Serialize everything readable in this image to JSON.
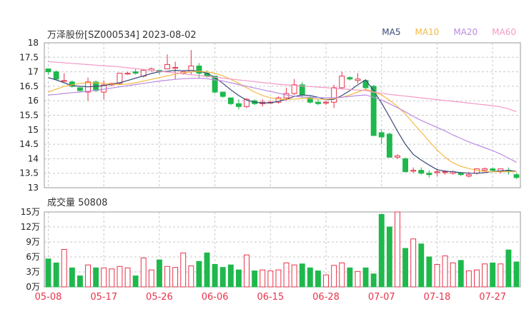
{
  "header": {
    "title": "万泽股份[SZ000534] 2023-08-02",
    "legend": [
      {
        "label": "MA5",
        "color": "#3a4a7a"
      },
      {
        "label": "MA10",
        "color": "#f5b942"
      },
      {
        "label": "MA20",
        "color": "#b98ae0"
      },
      {
        "label": "MA60",
        "color": "#f29ac6"
      }
    ]
  },
  "volume_label": "成交量 50808",
  "colors": {
    "up": "#e8334a",
    "down": "#1fb84c",
    "grid": "#c8c8c8",
    "axis": "#222222",
    "date": "#e8334a"
  },
  "chart_data": [
    {
      "type": "candlestick",
      "title": "万泽股份[SZ000534] 2023-08-02",
      "ylim": [
        13,
        18
      ],
      "y_ticks": [
        13,
        13.5,
        14,
        14.5,
        15,
        15.5,
        16,
        16.5,
        17,
        17.5,
        18
      ],
      "x_tick_labels": [
        {
          "label": "05-08",
          "index": 0
        },
        {
          "label": "05-17",
          "index": 7
        },
        {
          "label": "05-26",
          "index": 14
        },
        {
          "label": "06-06",
          "index": 21
        },
        {
          "label": "06-15",
          "index": 28
        },
        {
          "label": "06-28",
          "index": 35
        },
        {
          "label": "07-07",
          "index": 42
        },
        {
          "label": "07-18",
          "index": 49
        },
        {
          "label": "07-27",
          "index": 56
        }
      ],
      "ohlc": [
        [
          17.1,
          17.1,
          16.9,
          17.0
        ],
        [
          17.0,
          17.05,
          16.7,
          16.75
        ],
        [
          16.7,
          16.95,
          16.65,
          16.7
        ],
        [
          16.65,
          16.7,
          16.45,
          16.5
        ],
        [
          16.45,
          16.45,
          16.3,
          16.35
        ],
        [
          16.3,
          16.8,
          16.0,
          16.65
        ],
        [
          16.65,
          16.7,
          16.3,
          16.35
        ],
        [
          16.3,
          16.7,
          16.05,
          16.55
        ],
        [
          16.55,
          16.6,
          16.5,
          16.6
        ],
        [
          16.6,
          16.95,
          16.55,
          16.95
        ],
        [
          16.95,
          17.0,
          16.9,
          16.95
        ],
        [
          17.0,
          17.1,
          16.9,
          16.95
        ],
        [
          16.85,
          17.1,
          16.8,
          17.05
        ],
        [
          17.05,
          17.15,
          17.0,
          17.1
        ],
        [
          17.05,
          17.05,
          16.9,
          17.0
        ],
        [
          17.1,
          17.6,
          17.1,
          17.25
        ],
        [
          17.15,
          17.35,
          16.75,
          17.15
        ],
        [
          16.95,
          17.0,
          16.9,
          17.0
        ],
        [
          17.0,
          17.75,
          16.9,
          17.2
        ],
        [
          17.2,
          17.3,
          16.8,
          16.95
        ],
        [
          16.95,
          17.05,
          16.8,
          16.85
        ],
        [
          16.85,
          16.85,
          16.25,
          16.3
        ],
        [
          16.3,
          16.3,
          16.1,
          16.15
        ],
        [
          16.1,
          16.1,
          15.85,
          15.9
        ],
        [
          15.9,
          16.05,
          15.7,
          15.8
        ],
        [
          15.8,
          16.1,
          15.75,
          16.05
        ],
        [
          16.0,
          16.05,
          15.85,
          15.9
        ],
        [
          15.9,
          16.05,
          15.8,
          15.95
        ],
        [
          15.95,
          16.0,
          15.9,
          15.95
        ],
        [
          15.95,
          16.15,
          15.9,
          16.1
        ],
        [
          16.1,
          16.45,
          16.0,
          16.25
        ],
        [
          16.25,
          16.75,
          16.2,
          16.55
        ],
        [
          16.55,
          16.65,
          16.1,
          16.2
        ],
        [
          16.1,
          16.15,
          15.9,
          15.95
        ],
        [
          15.95,
          16.05,
          15.85,
          15.9
        ],
        [
          15.95,
          16.0,
          15.85,
          15.95
        ],
        [
          15.95,
          16.55,
          15.75,
          16.45
        ],
        [
          16.45,
          17.0,
          16.4,
          16.85
        ],
        [
          16.8,
          16.85,
          16.7,
          16.75
        ],
        [
          16.7,
          16.95,
          16.6,
          16.75
        ],
        [
          16.7,
          16.75,
          16.35,
          16.45
        ],
        [
          16.5,
          16.55,
          14.8,
          14.8
        ],
        [
          14.9,
          15.0,
          14.5,
          14.75
        ],
        [
          14.85,
          14.9,
          14.05,
          14.05
        ],
        [
          14.05,
          14.15,
          14.0,
          14.1
        ],
        [
          14.0,
          14.05,
          13.55,
          13.55
        ],
        [
          13.6,
          13.7,
          13.5,
          13.6
        ],
        [
          13.6,
          13.7,
          13.45,
          13.5
        ],
        [
          13.5,
          13.6,
          13.35,
          13.45
        ],
        [
          13.55,
          13.65,
          13.4,
          13.55
        ],
        [
          13.55,
          13.6,
          13.45,
          13.55
        ],
        [
          13.5,
          13.6,
          13.45,
          13.55
        ],
        [
          13.5,
          13.5,
          13.4,
          13.45
        ],
        [
          13.4,
          13.55,
          13.35,
          13.45
        ],
        [
          13.5,
          13.65,
          13.45,
          13.65
        ],
        [
          13.6,
          13.7,
          13.55,
          13.65
        ],
        [
          13.65,
          13.7,
          13.55,
          13.6
        ],
        [
          13.55,
          13.65,
          13.5,
          13.65
        ],
        [
          13.6,
          13.7,
          13.45,
          13.55
        ],
        [
          13.45,
          13.5,
          13.3,
          13.35
        ]
      ],
      "ma": {
        "MA5": [
          16.8,
          16.72,
          16.62,
          16.52,
          16.5,
          16.48,
          16.5,
          16.52,
          16.58,
          16.62,
          16.7,
          16.78,
          16.86,
          16.94,
          17.0,
          17.02,
          17.05,
          17.04,
          17.05,
          17.02,
          16.95,
          16.8,
          16.6,
          16.38,
          16.18,
          16.02,
          15.95,
          15.92,
          15.93,
          15.98,
          16.05,
          16.15,
          16.2,
          16.18,
          16.12,
          16.04,
          16.05,
          16.18,
          16.35,
          16.55,
          16.72,
          16.35,
          15.92,
          15.45,
          14.95,
          14.5,
          14.15,
          13.95,
          13.78,
          13.62,
          13.57,
          13.55,
          13.52,
          13.5,
          13.5,
          13.52,
          13.56,
          13.58,
          13.6,
          13.56
        ],
        "MA10": [
          16.3,
          16.4,
          16.5,
          16.55,
          16.6,
          16.62,
          16.62,
          16.6,
          16.58,
          16.56,
          16.58,
          16.62,
          16.68,
          16.74,
          16.8,
          16.86,
          16.92,
          16.96,
          17.0,
          17.02,
          17.0,
          16.95,
          16.86,
          16.74,
          16.6,
          16.45,
          16.3,
          16.18,
          16.1,
          16.06,
          16.05,
          16.06,
          16.08,
          16.08,
          16.06,
          16.05,
          16.08,
          16.12,
          16.2,
          16.3,
          16.4,
          16.3,
          16.2,
          16.02,
          15.8,
          15.55,
          15.22,
          14.92,
          14.6,
          14.3,
          14.05,
          13.86,
          13.74,
          13.66,
          13.6,
          13.56,
          13.55,
          13.55,
          13.56,
          13.55
        ],
        "MA20": [
          16.2,
          16.22,
          16.25,
          16.28,
          16.3,
          16.33,
          16.36,
          16.4,
          16.44,
          16.48,
          16.52,
          16.56,
          16.6,
          16.64,
          16.68,
          16.71,
          16.74,
          16.76,
          16.77,
          16.78,
          16.76,
          16.72,
          16.68,
          16.62,
          16.56,
          16.5,
          16.44,
          16.38,
          16.32,
          16.26,
          16.2,
          16.16,
          16.13,
          16.12,
          16.11,
          16.1,
          16.1,
          16.12,
          16.15,
          16.18,
          16.2,
          16.12,
          16.02,
          15.9,
          15.76,
          15.62,
          15.46,
          15.32,
          15.2,
          15.08,
          14.96,
          14.82,
          14.7,
          14.58,
          14.48,
          14.38,
          14.28,
          14.16,
          14.02,
          13.88
        ],
        "MA60": [
          17.35,
          17.33,
          17.31,
          17.29,
          17.27,
          17.25,
          17.23,
          17.21,
          17.19,
          17.17,
          17.14,
          17.11,
          17.08,
          17.05,
          17.02,
          16.99,
          16.96,
          16.93,
          16.9,
          16.87,
          16.84,
          16.81,
          16.78,
          16.75,
          16.72,
          16.69,
          16.66,
          16.63,
          16.6,
          16.57,
          16.55,
          16.53,
          16.51,
          16.49,
          16.47,
          16.45,
          16.43,
          16.41,
          16.39,
          16.37,
          16.35,
          16.3,
          16.26,
          16.22,
          16.19,
          16.16,
          16.13,
          16.1,
          16.07,
          16.04,
          16.01,
          15.98,
          15.95,
          15.92,
          15.89,
          15.86,
          15.83,
          15.79,
          15.72,
          15.62
        ]
      }
    },
    {
      "type": "bar",
      "title": "成交量 50808",
      "ylim": [
        0,
        150000
      ],
      "y_ticks": [
        {
          "value": 0,
          "label": "0万"
        },
        {
          "value": 30000,
          "label": "3万"
        },
        {
          "value": 60000,
          "label": "6万"
        },
        {
          "value": 90000,
          "label": "9万"
        },
        {
          "value": 120000,
          "label": "12万"
        },
        {
          "value": 150000,
          "label": "15万"
        }
      ],
      "values": [
        56000,
        48000,
        75000,
        38000,
        22000,
        44000,
        38000,
        38000,
        36000,
        41000,
        38000,
        22000,
        58000,
        34000,
        54000,
        41000,
        39000,
        68000,
        42000,
        51000,
        68000,
        45000,
        39000,
        44000,
        34000,
        64000,
        32000,
        34000,
        32000,
        34000,
        48000,
        44000,
        46000,
        38000,
        32000,
        24000,
        43000,
        48000,
        38000,
        31000,
        38000,
        26000,
        145000,
        120000,
        150000,
        77000,
        96000,
        86000,
        60000,
        45000,
        62000,
        48000,
        53000,
        32000,
        34000,
        46000,
        48000,
        46000,
        74000,
        50000
      ],
      "colors_note": "bar color follows the candle direction"
    }
  ]
}
